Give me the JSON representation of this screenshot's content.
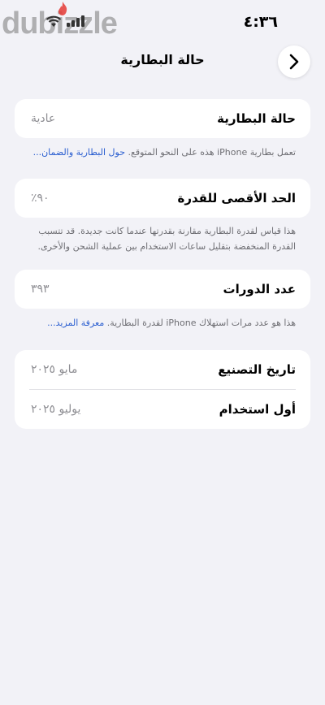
{
  "status_bar": {
    "watermark": "dubizzle",
    "time": "٤:٣٦"
  },
  "nav": {
    "title": "حالة البطارية"
  },
  "battery_health": {
    "label": "حالة البطارية",
    "value": "عادية",
    "note": "تعمل بطارية iPhone هذه على النحو المتوقع.",
    "link": "حول البطارية والضمان..."
  },
  "max_capacity": {
    "label": "الحد الأقصى للقدرة",
    "value": "٩٠٪",
    "note": "هذا قياس لقدرة البطارية مقارنة بقدرتها عندما كانت جديدة. قد تتسبب القدرة المنخفضة بتقليل ساعات الاستخدام بين عملية الشحن والأخرى."
  },
  "cycle_count": {
    "label": "عدد الدورات",
    "value": "٣٩٣",
    "note": "هذا هو عدد مرات استهلاك iPhone لقدرة البطارية.",
    "link": "معرفة المزيد..."
  },
  "dates": {
    "manufacture_label": "تاريخ التصنيع",
    "manufacture_value": "مايو ٢٠٢٥",
    "first_use_label": "أول استخدام",
    "first_use_value": "يوليو ٢٠٢٥"
  },
  "colors": {
    "background": "#f2f2f7",
    "link": "#2a5ed0",
    "secondary_text": "#8e8e93",
    "watermark_flame": "#e53935"
  }
}
